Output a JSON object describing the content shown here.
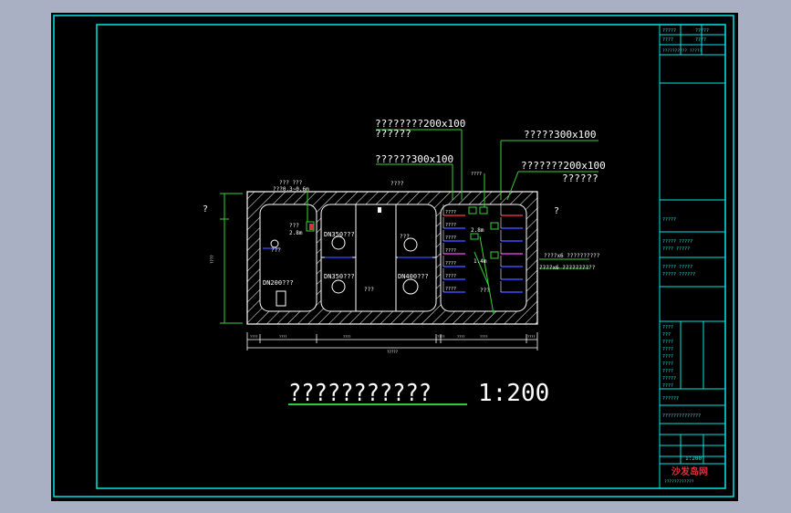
{
  "colors": {
    "frame": "#00e5e5",
    "wall": "#ffffff",
    "leader": "#3ad03a",
    "underline": "#2ecc40",
    "cable_red": "#e0303a",
    "cable_blue": "#3a4cff",
    "cable_magenta": "#d040d0"
  },
  "labels": {
    "tray_top_center_1": "????????200x100",
    "tray_top_center_2": "??????",
    "tray_left": "??????300x100",
    "tray_top_right": "?????300x100",
    "tray_right_1": "???????200x100",
    "tray_right_2": "??????",
    "side_left_mark": "?",
    "side_right_mark": "?",
    "vent_label": "??? ???",
    "vent_size": "???0.3~0.6m",
    "hatch_label": "????",
    "pipe_dn350_a": "DN350???",
    "pipe_dn350_b": "DN350???",
    "pipe_dn200": "DN200???",
    "pipe_dn400": "DN400???",
    "left_tag": "???",
    "left_dim": "2.8m",
    "center_tag": "???",
    "mid_small": "????",
    "mid_dim": "2.8m",
    "mid_dim_2": "1.4m",
    "mid_tag": "???",
    "cable_count_1": "????x6 ??????????",
    "cable_count_2": "????x6 ??????????",
    "left_tag_2": "???",
    "right_tag_2": "???",
    "bracket_labels": [
      "????",
      "????",
      "????",
      "????",
      "????",
      "????",
      "????"
    ],
    "vertical_dim": "????",
    "bottom_dims": [
      "????",
      "????",
      "????",
      "????",
      "????",
      "????",
      "????"
    ],
    "bottom_total": "?????",
    "main_title": "???????????",
    "main_scale": "1:200"
  },
  "title_block": {
    "top": [
      "?????",
      "?????",
      "????",
      "????"
    ],
    "top_row": "?????????? ?????",
    "mid_1": "?????",
    "mid_2": "????? ?????",
    "mid_3": "???? ?????",
    "mid_4": "????? ?????",
    "mid_5": "????? ??????",
    "left_items": [
      "????",
      "???",
      "????",
      "????",
      "????",
      "????",
      "????",
      "?????",
      "????"
    ],
    "drawing_name": "??????",
    "drawing_title": "??????????????",
    "scale_row": "1:200",
    "company": "沙发岛网",
    "company_sub": "????????????"
  }
}
